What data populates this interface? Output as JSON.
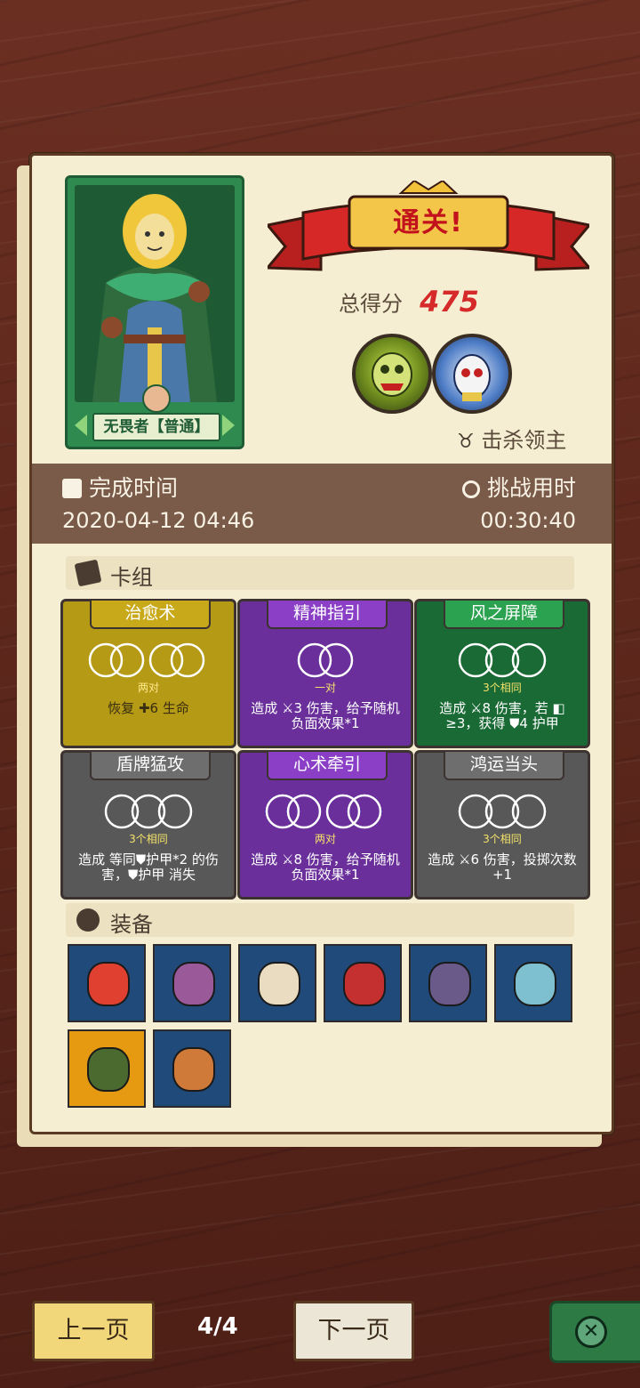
{
  "hero": {
    "name": "无畏者【普通】"
  },
  "result": {
    "banner": "通关!",
    "score_label": "总得分",
    "score": "475",
    "kill_label": "击杀领主"
  },
  "time": {
    "finish_label": "完成时间",
    "finish_value": "2020-04-12 04:46",
    "challenge_label": "挑战用时",
    "challenge_value": "00:30:40"
  },
  "deck": {
    "title": "卡组",
    "cards": [
      {
        "name": "治愈术",
        "tag": "两对",
        "desc": "恢复 ✚6 生命",
        "color": "yellow",
        "rings": 4
      },
      {
        "name": "精神指引",
        "tag": "一对",
        "desc": "造成 ⚔3 伤害，给予随机负面效果*1",
        "color": "purple",
        "rings": 2
      },
      {
        "name": "风之屏障",
        "tag": "3个相同",
        "desc": "造成 ⚔8 伤害，若 ◧ ≥3，获得 ⛊4 护甲",
        "color": "green",
        "rings": 3
      },
      {
        "name": "盾牌猛攻",
        "tag": "3个相同",
        "desc": "造成 等同⛊护甲*2 的伤害，⛊护甲 消失",
        "color": "gray",
        "rings": 3
      },
      {
        "name": "心术牵引",
        "tag": "两对",
        "desc": "造成 ⚔8 伤害，给予随机负面效果*1",
        "color": "purple",
        "rings": 4
      },
      {
        "name": "鸿运当头",
        "tag": "3个相同",
        "desc": "造成 ⚔6 伤害，投掷次数+1",
        "color": "gray",
        "rings": 3
      }
    ]
  },
  "equipment": {
    "title": "装备",
    "items": [
      {
        "icon": "skull-rocket-icon",
        "bg": "blue"
      },
      {
        "icon": "wheel-shield-icon",
        "bg": "blue"
      },
      {
        "icon": "fire-scroll-icon",
        "bg": "blue"
      },
      {
        "icon": "red-shield-icon",
        "bg": "blue"
      },
      {
        "icon": "gem-shield-icon",
        "bg": "blue"
      },
      {
        "icon": "axe-icon",
        "bg": "blue"
      },
      {
        "icon": "green-mask-icon",
        "bg": "gold"
      },
      {
        "icon": "ore-rock-icon",
        "bg": "blue"
      }
    ]
  },
  "nav": {
    "prev": "上一页",
    "page": "4/4",
    "next": "下一页"
  }
}
